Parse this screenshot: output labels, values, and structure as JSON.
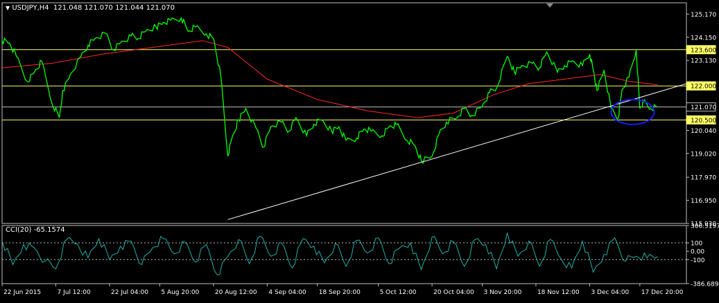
{
  "header": {
    "symbol": "USDJPY,H4",
    "ohlc": "121.048 121.070 121.044 121.070"
  },
  "colors": {
    "background": "#000000",
    "price": "#00ff00",
    "ma": "#ff2a2a",
    "hline": "#ffff66",
    "trendline": "#ffffff",
    "circle": "#1a1aff",
    "cci": "#20b2aa",
    "frame": "#c0c0c0"
  },
  "chart_data": {
    "type": "line",
    "main": {
      "ylim": [
        115.93,
        125.67
      ],
      "y_ticks": [
        "125.170",
        "124.150",
        "123.130",
        "122.110",
        "121.070",
        "120.040",
        "119.020",
        "117.970",
        "116.950",
        "115.930"
      ],
      "y_tick_values": [
        125.17,
        124.15,
        123.13,
        122.11,
        121.07,
        120.04,
        119.02,
        117.97,
        116.95,
        115.93
      ],
      "x_labels": [
        "22 Jun 2015",
        "7 Jul 12:00",
        "22 Jul 04:00",
        "5 Aug 20:00",
        "20 Aug 12:00",
        "4 Sep 04:00",
        "18 Sep 20:00",
        "5 Oct 12:00",
        "20 Oct 04:00",
        "3 Nov 20:00",
        "18 Nov 12:00",
        "3 Dec 04:00",
        "17 Dec 20:00"
      ],
      "x_label_dates": [
        "2015-06-22",
        "2015-07-07",
        "2015-07-22",
        "2015-08-05",
        "2015-08-20",
        "2015-09-04",
        "2015-09-18",
        "2015-10-05",
        "2015-10-20",
        "2015-11-03",
        "2015-11-18",
        "2015-12-03",
        "2015-12-17"
      ],
      "xlim": [
        "2015-06-22",
        "2015-12-30"
      ],
      "series": [
        {
          "kind": "price",
          "dates": [
            "2015-06-22",
            "2015-06-24",
            "2015-06-26",
            "2015-06-29",
            "2015-07-01",
            "2015-07-03",
            "2015-07-06",
            "2015-07-08",
            "2015-07-09",
            "2015-07-11",
            "2015-07-14",
            "2015-07-16",
            "2015-07-18",
            "2015-07-21",
            "2015-07-23",
            "2015-07-25",
            "2015-07-28",
            "2015-07-30",
            "2015-08-01",
            "2015-08-04",
            "2015-08-06",
            "2015-08-08",
            "2015-08-11",
            "2015-08-13",
            "2015-08-15",
            "2015-08-18",
            "2015-08-20",
            "2015-08-22",
            "2015-08-24",
            "2015-08-25",
            "2015-08-27",
            "2015-08-29",
            "2015-09-01",
            "2015-09-03",
            "2015-09-05",
            "2015-09-08",
            "2015-09-10",
            "2015-09-12",
            "2015-09-15",
            "2015-09-17",
            "2015-09-19",
            "2015-09-22",
            "2015-09-24",
            "2015-09-26",
            "2015-09-29",
            "2015-10-01",
            "2015-10-03",
            "2015-10-06",
            "2015-10-08",
            "2015-10-10",
            "2015-10-13",
            "2015-10-15",
            "2015-10-17",
            "2015-10-20",
            "2015-10-22",
            "2015-10-24",
            "2015-10-27",
            "2015-10-29",
            "2015-10-31",
            "2015-11-03",
            "2015-11-05",
            "2015-11-07",
            "2015-11-10",
            "2015-11-12",
            "2015-11-14",
            "2015-11-17",
            "2015-11-19",
            "2015-11-21",
            "2015-11-24",
            "2015-11-26",
            "2015-11-28",
            "2015-12-01",
            "2015-12-03",
            "2015-12-04",
            "2015-12-05",
            "2015-12-07",
            "2015-12-09",
            "2015-12-11",
            "2015-12-12",
            "2015-12-14",
            "2015-12-16",
            "2015-12-17",
            "2015-12-18",
            "2015-12-20",
            "2015-12-22"
          ],
          "values": [
            124.0,
            123.9,
            123.3,
            122.2,
            122.6,
            123.1,
            121.2,
            120.6,
            121.8,
            122.5,
            123.3,
            123.8,
            124.1,
            124.3,
            123.6,
            123.9,
            124.2,
            124.1,
            124.4,
            124.6,
            124.8,
            124.9,
            125.0,
            124.4,
            124.6,
            124.3,
            124.1,
            122.5,
            118.9,
            119.6,
            120.5,
            121.0,
            120.1,
            119.3,
            120.2,
            120.4,
            120.0,
            120.6,
            119.8,
            120.3,
            120.5,
            120.0,
            120.2,
            119.6,
            119.7,
            120.1,
            120.0,
            119.8,
            120.2,
            120.3,
            119.6,
            119.4,
            118.7,
            118.9,
            119.9,
            120.4,
            120.6,
            121.0,
            120.7,
            121.1,
            121.7,
            121.9,
            123.3,
            122.6,
            122.9,
            123.0,
            122.8,
            123.5,
            122.6,
            122.9,
            123.1,
            122.9,
            123.4,
            122.7,
            121.8,
            122.7,
            121.0,
            120.6,
            121.8,
            122.4,
            123.6,
            121.0,
            121.3,
            121.0,
            121.07
          ]
        },
        {
          "kind": "moving-average",
          "dates": [
            "2015-06-22",
            "2015-07-06",
            "2015-07-20",
            "2015-08-03",
            "2015-08-17",
            "2015-08-24",
            "2015-09-04",
            "2015-09-18",
            "2015-10-02",
            "2015-10-16",
            "2015-10-26",
            "2015-11-06",
            "2015-11-16",
            "2015-11-26",
            "2015-12-06",
            "2015-12-14",
            "2015-12-22"
          ],
          "values": [
            122.8,
            123.0,
            123.4,
            123.7,
            124.0,
            123.7,
            122.3,
            121.4,
            120.9,
            120.6,
            120.8,
            121.6,
            122.1,
            122.3,
            122.5,
            122.2,
            122.05
          ]
        }
      ],
      "horizontal_lines": [
        {
          "value": 123.6,
          "label": "123.600",
          "highlighted": true
        },
        {
          "value": 122.0,
          "label": "122.000",
          "highlighted": true
        },
        {
          "value": 121.07,
          "label": "121.070",
          "highlighted": false
        },
        {
          "value": 120.5,
          "label": "120.500",
          "highlighted": true
        }
      ],
      "trendline": {
        "from": [
          "2015-08-24",
          116.1
        ],
        "to": [
          "2015-12-30",
          122.1
        ]
      },
      "annotation_ellipse": {
        "center": [
          "2015-12-15",
          120.85
        ],
        "radius_days": 6,
        "radius_price": 0.55
      }
    },
    "indicator": {
      "label": "CCI(20) -65.1574",
      "ylim": [
        -386.6892,
        306.5197
      ],
      "y_ticks": [
        "306.5197",
        "100",
        "0.00",
        "-100",
        "-386.6892"
      ],
      "y_tick_values": [
        306.5197,
        100,
        0,
        -100,
        -386.6892
      ],
      "levels": [
        100,
        -100
      ],
      "dates": [
        "2015-06-22",
        "2015-06-25",
        "2015-06-28",
        "2015-07-01",
        "2015-07-04",
        "2015-07-07",
        "2015-07-10",
        "2015-07-13",
        "2015-07-16",
        "2015-07-19",
        "2015-07-22",
        "2015-07-25",
        "2015-07-28",
        "2015-07-31",
        "2015-08-03",
        "2015-08-06",
        "2015-08-09",
        "2015-08-12",
        "2015-08-15",
        "2015-08-18",
        "2015-08-21",
        "2015-08-24",
        "2015-08-27",
        "2015-08-30",
        "2015-09-02",
        "2015-09-05",
        "2015-09-08",
        "2015-09-11",
        "2015-09-14",
        "2015-09-17",
        "2015-09-20",
        "2015-09-23",
        "2015-09-26",
        "2015-09-29",
        "2015-10-02",
        "2015-10-05",
        "2015-10-08",
        "2015-10-11",
        "2015-10-14",
        "2015-10-17",
        "2015-10-20",
        "2015-10-23",
        "2015-10-26",
        "2015-10-29",
        "2015-11-01",
        "2015-11-04",
        "2015-11-07",
        "2015-11-10",
        "2015-11-13",
        "2015-11-16",
        "2015-11-19",
        "2015-11-22",
        "2015-11-25",
        "2015-11-28",
        "2015-12-01",
        "2015-12-04",
        "2015-12-07",
        "2015-12-10",
        "2015-12-13",
        "2015-12-16",
        "2015-12-19",
        "2015-12-22"
      ],
      "values": [
        120,
        -160,
        80,
        40,
        -120,
        -210,
        140,
        90,
        -80,
        150,
        -100,
        60,
        120,
        -160,
        40,
        150,
        -30,
        110,
        -130,
        80,
        -280,
        -60,
        140,
        -150,
        180,
        -60,
        100,
        -200,
        150,
        60,
        -140,
        90,
        -180,
        130,
        -20,
        160,
        -150,
        40,
        100,
        -220,
        170,
        -30,
        110,
        -180,
        140,
        80,
        -210,
        220,
        -60,
        120,
        -180,
        140,
        -90,
        -200,
        120,
        -250,
        -40,
        160,
        -120,
        -60,
        -80,
        -65
      ]
    }
  }
}
